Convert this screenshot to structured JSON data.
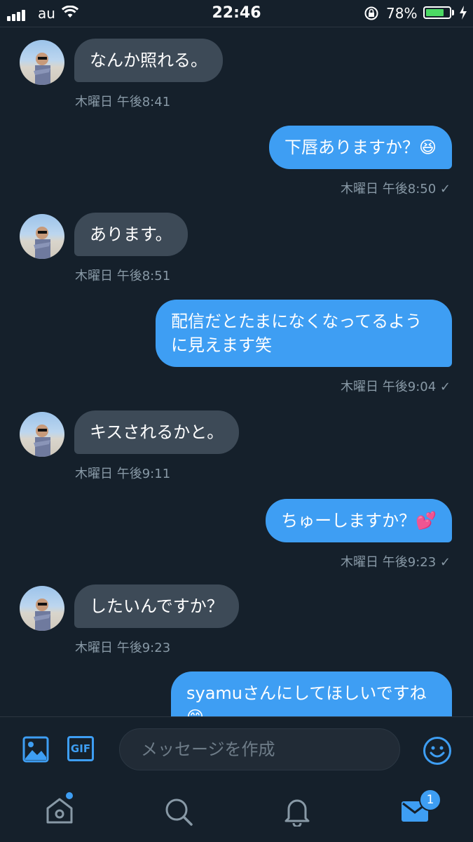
{
  "status_bar": {
    "carrier": "au",
    "time": "22:46",
    "battery_percent": "78%",
    "battery_level": 0.78
  },
  "conversation": {
    "messages": [
      {
        "direction": "in",
        "text": "なんか照れる。",
        "time": "木曜日 午後8:41"
      },
      {
        "direction": "out",
        "text": "下唇ありますか？",
        "emoji": "😆",
        "time": "木曜日 午後8:50",
        "check": "✓"
      },
      {
        "direction": "in",
        "text": "あります。",
        "time": "木曜日 午後8:51"
      },
      {
        "direction": "out",
        "text_line1": "配信だとたまになくなってるよう",
        "text_line2": "に見えます笑",
        "time": "木曜日 午後9:04",
        "check": "✓"
      },
      {
        "direction": "in",
        "text": "キスされるかと。",
        "time": "木曜日 午後9:11"
      },
      {
        "direction": "out",
        "text": "ちゅーしますか？",
        "emoji": "💕",
        "time": "木曜日 午後9:23",
        "check": "✓"
      },
      {
        "direction": "in",
        "text": "したいんですか？",
        "time": "木曜日 午後9:23"
      },
      {
        "direction": "out",
        "text_line1": "syamuさんにしてほしいですね",
        "emoji": "😊"
      }
    ]
  },
  "composer": {
    "placeholder": "メッセージを作成",
    "gif_label": "GIF"
  },
  "tab_bar": {
    "messages_badge": "1"
  },
  "colors": {
    "background": "#15202b",
    "incoming_bubble": "#3d4a57",
    "outgoing_bubble": "#3e9ef3",
    "accent": "#3e9ef3",
    "timestamp": "#8899a6"
  }
}
